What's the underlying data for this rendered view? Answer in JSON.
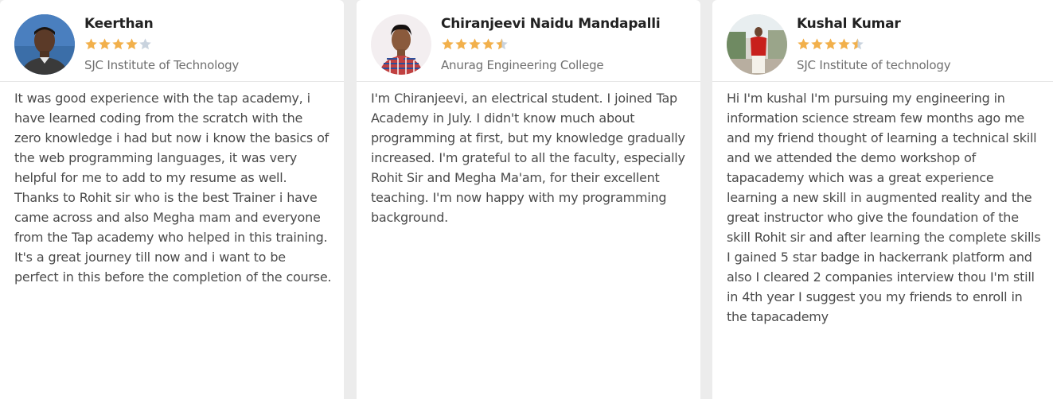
{
  "reviews": [
    {
      "name": "Keerthan",
      "rating": 4,
      "college": "SJC Institute of Technology",
      "text": "It was good experience with the tap academy, i have learned coding from the scratch with the zero knowledge i had but now i know the basics of the web programming languages, it was very helpful for me to add to my resume as well. Thanks to Rohit sir who is the best Trainer i have came across and also Megha mam and everyone from the Tap academy who helped in this training. It's a great journey till now and i want to be perfect in this before the completion of the course."
    },
    {
      "name": "Chiranjeevi Naidu Mandapalli",
      "rating": 4.5,
      "college": "Anurag Engineering College",
      "text": "I'm Chiranjeevi, an electrical student. I joined Tap Academy in July. I didn't know much about programming at first, but my knowledge gradually increased. I'm grateful to all the faculty, especially Rohit Sir and Megha Ma'am, for their excellent teaching. I'm now happy with my programming background."
    },
    {
      "name": "Kushal Kumar",
      "rating": 4.5,
      "college": "SJC Institute of technology",
      "text": "Hi I'm kushal I'm pursuing my engineering in information science stream few months ago me and my friend thought of learning a technical skill and we attended the demo workshop of tapacademy which was a great experience learning a new skill in augmented reality and the great instructor who give the foundation of the skill Rohit sir and after learning the complete skills I gained 5 star badge in hackerrank platform and also I cleared 2 companies interview thou I'm still in 4th year I suggest you my friends to enroll in the tapacademy"
    }
  ],
  "colors": {
    "star_filled": "#f2b04b",
    "star_empty": "#c9d3de",
    "name": "#222222",
    "college": "#6f6f6f",
    "text": "#4a4a4a"
  },
  "icons": {
    "star": "star-icon",
    "half_star": "half-star-icon",
    "avatar": "user-photo"
  }
}
